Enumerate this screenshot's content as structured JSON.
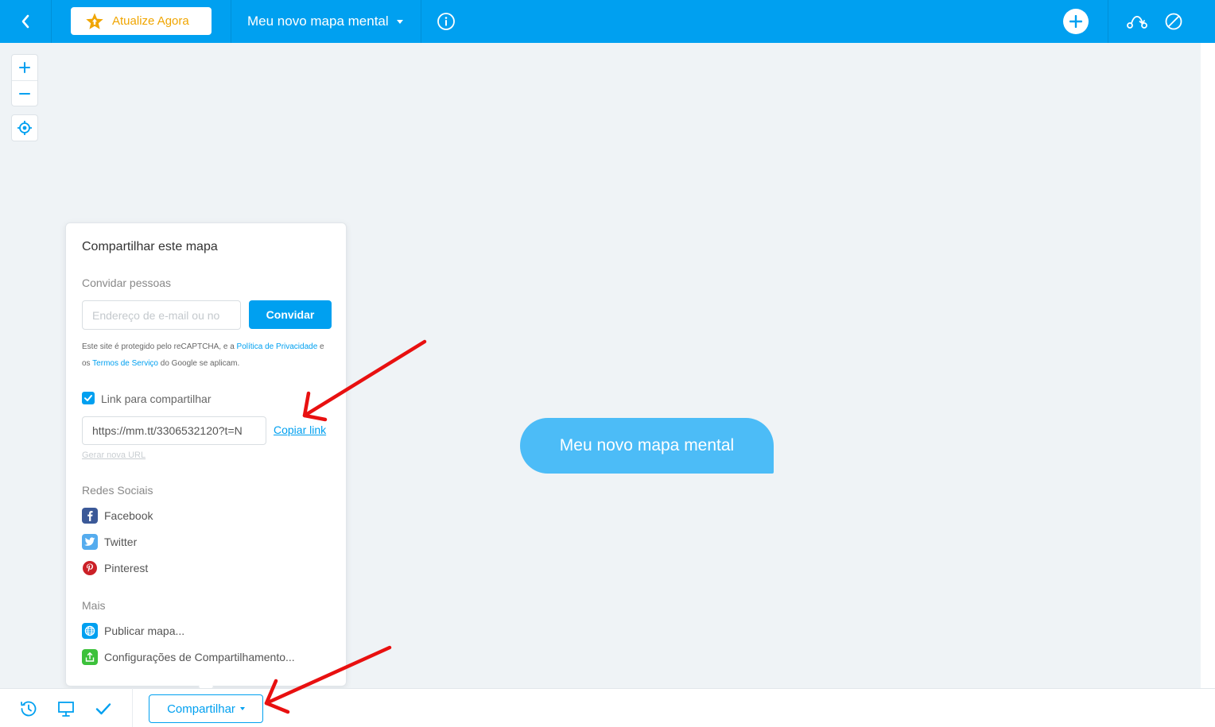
{
  "topbar": {
    "upgrade_label": "Atualize Agora",
    "map_title": "Meu novo mapa mental"
  },
  "node": {
    "label": "Meu novo mapa mental"
  },
  "share_panel": {
    "title": "Compartilhar este mapa",
    "invite_heading": "Convidar pessoas",
    "email_placeholder": "Endereço de e-mail ou no",
    "invite_button": "Convidar",
    "recaptcha": {
      "text_1": "Este site é protegido pelo reCAPTCHA, e a ",
      "privacy_link": "Política de Privacidade",
      "text_2": " e os ",
      "terms_link": "Termos de Serviço",
      "text_3": " do Google se aplicam."
    },
    "link_checkbox_label": "Link para compartilhar",
    "link_checked": true,
    "share_url": "https://mm.tt/3306532120?t=N",
    "copy_link": "Copiar link",
    "new_url": "Gerar nova URL",
    "social_heading": "Redes Sociais",
    "social": [
      {
        "label": "Facebook",
        "icon": "facebook-icon",
        "color": "#3b5998"
      },
      {
        "label": "Twitter",
        "icon": "twitter-icon",
        "color": "#55acee"
      },
      {
        "label": "Pinterest",
        "icon": "pinterest-icon",
        "color": "#cb2027"
      }
    ],
    "more_heading": "Mais",
    "more": [
      {
        "label": "Publicar mapa...",
        "icon": "globe-icon",
        "color": "#00a0f0"
      },
      {
        "label": "Configurações de Compartilhamento...",
        "icon": "share-settings-icon",
        "color": "#3cc13b"
      }
    ]
  },
  "bottombar": {
    "share_button": "Compartilhar"
  },
  "colors": {
    "primary": "#00a0f0",
    "upgrade": "#f0a500",
    "node": "#4cbcf7",
    "annotation": "#e81010"
  }
}
